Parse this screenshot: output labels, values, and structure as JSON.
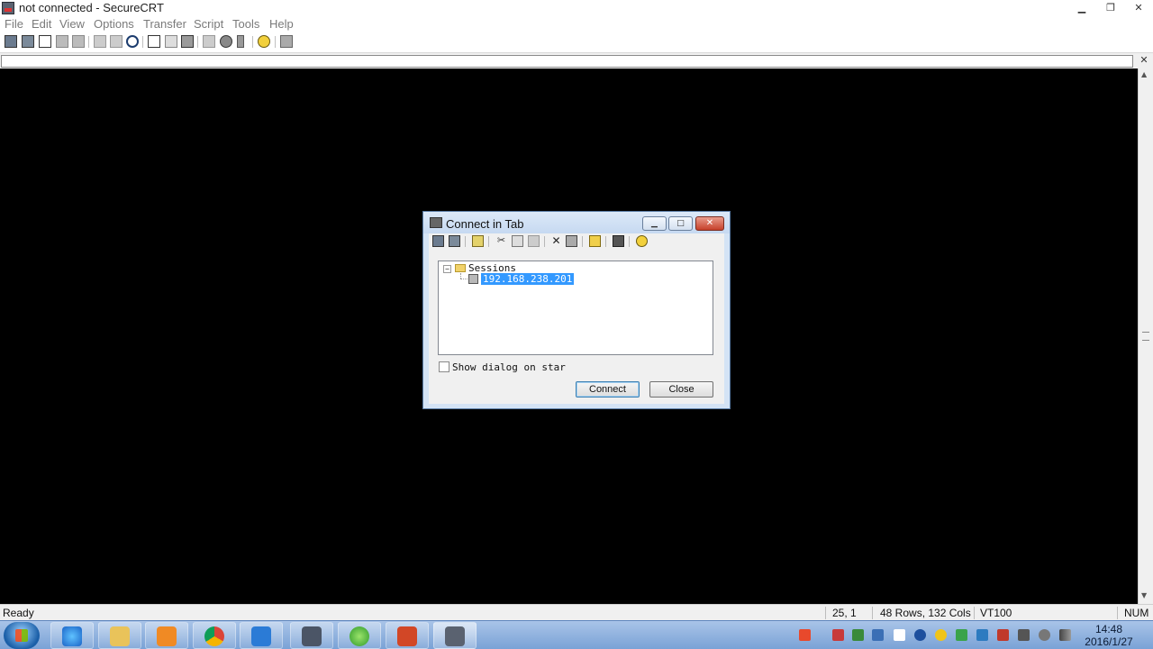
{
  "window": {
    "title": "not connected - SecureCRT"
  },
  "menu": [
    "File",
    "Edit",
    "View",
    "Options",
    "Transfer",
    "Script",
    "Tools",
    "Help"
  ],
  "toolbar_icons": [
    "connect-icon",
    "quick-connect-icon",
    "connect-in-tab-icon",
    "reconnect-icon",
    "disconnect-icon",
    "copy-icon",
    "paste-icon",
    "find-icon",
    "print-setup-icon",
    "print-selection-icon",
    "print-icon",
    "session-options-icon",
    "global-options-icon",
    "keymap-icon",
    "help-icon",
    "sftp-icon"
  ],
  "dialog": {
    "title": "Connect in Tab",
    "tree_root": "Sessions",
    "session": "192.168.238.201",
    "checkbox_label": "Show dialog on star",
    "connect_label": "Connect",
    "close_label": "Close"
  },
  "status": {
    "ready": "Ready",
    "position": "25,  1",
    "size": "48 Rows, 132 Cols",
    "emulation": "VT100",
    "num": "NUM"
  },
  "clock": {
    "time": "14:48",
    "date": "2016/1/27"
  },
  "colors": {
    "terminal": "#000000",
    "selection": "#3399ff",
    "taskbar": "#7aa2d6"
  }
}
